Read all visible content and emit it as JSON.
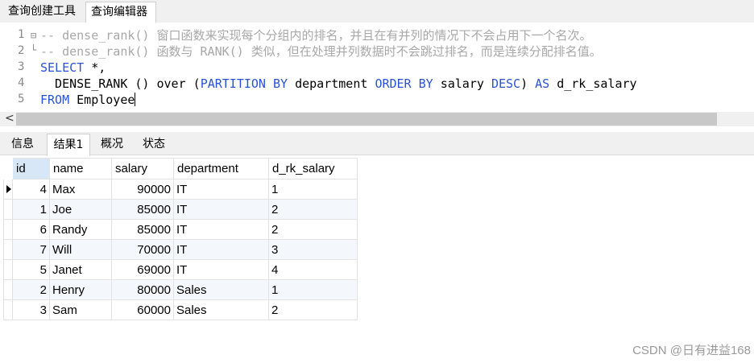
{
  "tabs": [
    "查询创建工具",
    "查询编辑器"
  ],
  "editor": {
    "line_numbers": [
      "1",
      "2",
      "3",
      "4",
      "5"
    ],
    "line1": "-- dense_rank() 窗口函数来实现每个分组内的排名，并且在有并列的情况下不会占用下一个名次。",
    "line2": "-- dense_rank() 函数与 RANK() 类似，但在处理并列数据时不会跳过排名，而是连续分配排名值。",
    "line3_kw": "SELECT",
    "line3_rest": " *,",
    "line4_a": "  DENSE_RANK () over (",
    "line4_kw1": "PARTITION BY",
    "line4_b": " department ",
    "line4_kw2": "ORDER BY",
    "line4_c": " salary ",
    "line4_kw3": "DESC",
    "line4_d": ") ",
    "line4_kw4": "AS",
    "line4_e": " d_rk_salary",
    "line5_kw": "FROM",
    "line5_rest": " Employee"
  },
  "scrollbar": {
    "left_arrow": "<"
  },
  "result_tabs": [
    "信息",
    "结果1",
    "概况",
    "状态"
  ],
  "table": {
    "columns": [
      "id",
      "name",
      "salary",
      "department",
      "d_rk_salary"
    ],
    "rows": [
      [
        "4",
        "Max",
        "90000",
        "IT",
        "1"
      ],
      [
        "1",
        "Joe",
        "85000",
        "IT",
        "2"
      ],
      [
        "6",
        "Randy",
        "85000",
        "IT",
        "2"
      ],
      [
        "7",
        "Will",
        "70000",
        "IT",
        "3"
      ],
      [
        "5",
        "Janet",
        "69000",
        "IT",
        "4"
      ],
      [
        "2",
        "Henry",
        "80000",
        "Sales",
        "1"
      ],
      [
        "3",
        "Sam",
        "60000",
        "Sales",
        "2"
      ]
    ]
  },
  "watermark": "CSDN @日有进益168",
  "colors": {
    "keyword": "#2a52d6",
    "comment": "#a8a8a8",
    "header_selected": "#d8e7f5"
  }
}
